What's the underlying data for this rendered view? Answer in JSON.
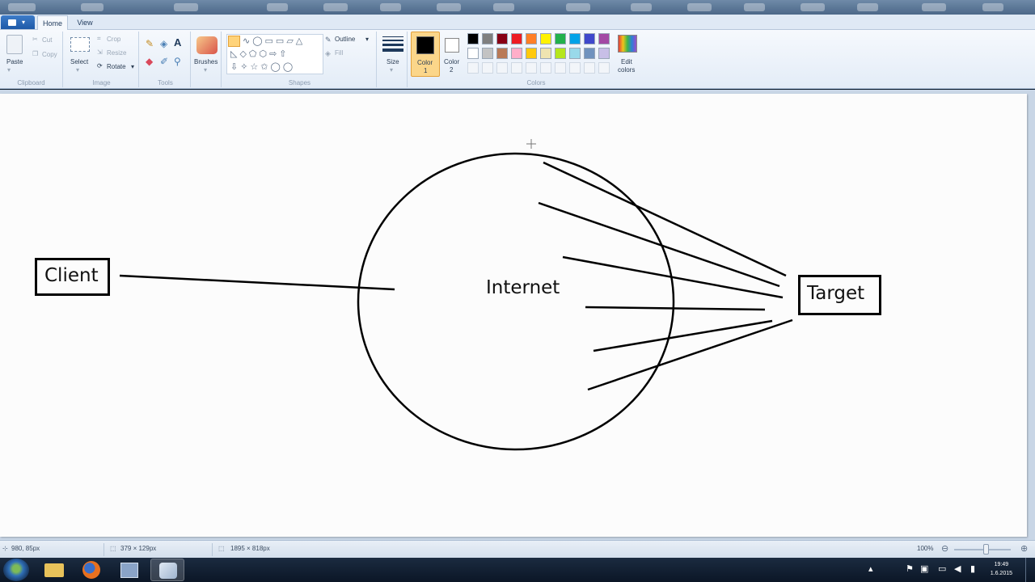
{
  "ribbon": {
    "tabs": [
      "Home",
      "View"
    ],
    "clipboard": {
      "paste": "Paste",
      "cut": "Cut",
      "copy": "Copy",
      "group": "Clipboard"
    },
    "image": {
      "select": "Select",
      "crop": "Crop",
      "resize": "Resize",
      "rotate": "Rotate",
      "group": "Image"
    },
    "tools": {
      "group": "Tools"
    },
    "brushes": {
      "label": "Brushes"
    },
    "shapes": {
      "outline": "Outline",
      "fill": "Fill",
      "group": "Shapes"
    },
    "size": {
      "label": "Size"
    },
    "color1": {
      "label": "Color",
      "num": "1",
      "value": "#000000"
    },
    "color2": {
      "label": "Color",
      "num": "2",
      "value": "#ffffff"
    },
    "colors": {
      "group": "Colors",
      "edit_label": "Edit",
      "edit_label2": "colors",
      "palette_row1": [
        "#000000",
        "#7f7f7f",
        "#880015",
        "#ed1c24",
        "#ff7f27",
        "#fff200",
        "#22b14c",
        "#00a2e8",
        "#3f48cc",
        "#a349a4"
      ],
      "palette_row2": [
        "#ffffff",
        "#c3c3c3",
        "#b97a57",
        "#ffaec9",
        "#ffc90e",
        "#efe4b0",
        "#b5e61d",
        "#99d9ea",
        "#7092be",
        "#c8bfe7"
      ]
    }
  },
  "canvas": {
    "client_label": "Client",
    "internet_label": "Internet",
    "target_label": "Target"
  },
  "status": {
    "cursor_pos": "980, 85px",
    "selection_size": "379 × 129px",
    "image_size": "1895 × 818px",
    "zoom": "100%"
  },
  "taskbar": {
    "time": "19:49",
    "date": "1.6.2015"
  }
}
